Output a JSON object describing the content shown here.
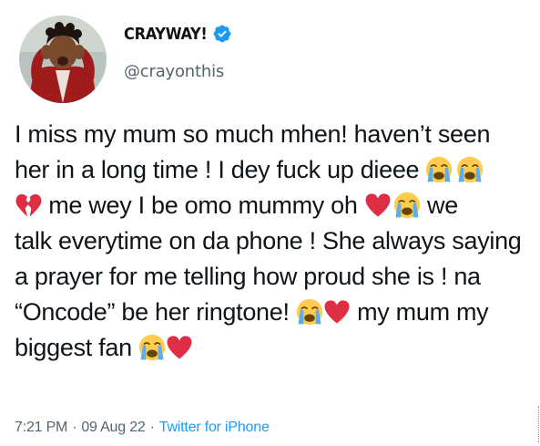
{
  "tweet": {
    "display_name": "CRAYWAY!",
    "handle": "@crayonthis",
    "lines": [
      [
        "I miss my mum so much mhen! haven’t seen"
      ],
      [
        "her in a long time ! I dey fuck up dieee "
      ],
      [
        " me wey I be omo mummy oh ",
        " we"
      ],
      [
        "talk everytime on da phone ! She always saying"
      ],
      [
        "a prayer for me telling how proud she is ! na"
      ],
      [
        "“Oncode” be her ringtone! ",
        " my mum my"
      ],
      [
        "biggest fan "
      ]
    ],
    "timestamp_time": "7:21 PM",
    "timestamp_date": "09 Aug 22",
    "separator": "·",
    "source": "Twitter for iPhone"
  },
  "colors": {
    "text": "#0f1419",
    "secondary": "#536471",
    "link": "#1d9bf0",
    "verified": "#1d9bf0"
  },
  "icons": {
    "verified": "verified-badge-icon",
    "crying": "loudly-crying-face-emoji",
    "broken_heart": "broken-heart-emoji",
    "heart": "red-heart-emoji"
  }
}
